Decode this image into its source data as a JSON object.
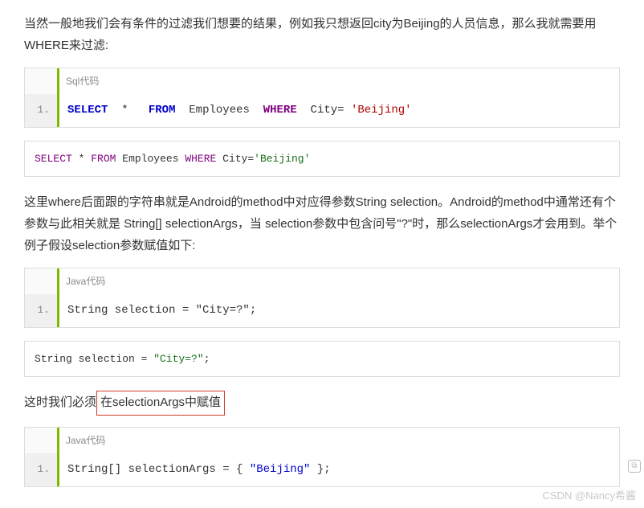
{
  "para1": "当然一般地我们会有条件的过滤我们想要的结果，例如我只想返回city为Beijing的人员信息，那么我就需要用WHERE来过滤:",
  "block1": {
    "label": "Sql代码",
    "lineno": "1.",
    "tokens": {
      "select": "SELECT",
      "star": "*",
      "from": "FROM",
      "employees": "Employees",
      "where": "WHERE",
      "cityeq": "City=",
      "beijing": "'Beijing'"
    }
  },
  "plain1": {
    "select": "SELECT",
    "star": "*",
    "from": "FROM",
    "employees": "Employees",
    "where": "WHERE",
    "cityeq": "City=",
    "beijing": "'Beijing'"
  },
  "para2": "这里where后面跟的字符串就是Android的method中对应得参数String selection。Android的method中通常还有个参数与此相关就是 String[] selectionArgs，当 selection参数中包含问号\"?\"时，那么selectionArgs才会用到。举个例子假设selection参数赋值如下:",
  "block2": {
    "label": "Java代码",
    "lineno": "1.",
    "code": "String selection = \"City=?\";"
  },
  "plain2": {
    "left": "String selection = ",
    "str": "\"City=?\"",
    "right": ";"
  },
  "para3_a": "这时我们必须",
  "para3_b": "在selectionArgs中赋值",
  "block3": {
    "label": "Java代码",
    "lineno": "1.",
    "left": "String[] selectionArgs = { ",
    "str": "\"Beijing\"",
    "right": " };"
  },
  "watermark": "CSDN @Nancy希酱",
  "icon_glyph": "⧉"
}
